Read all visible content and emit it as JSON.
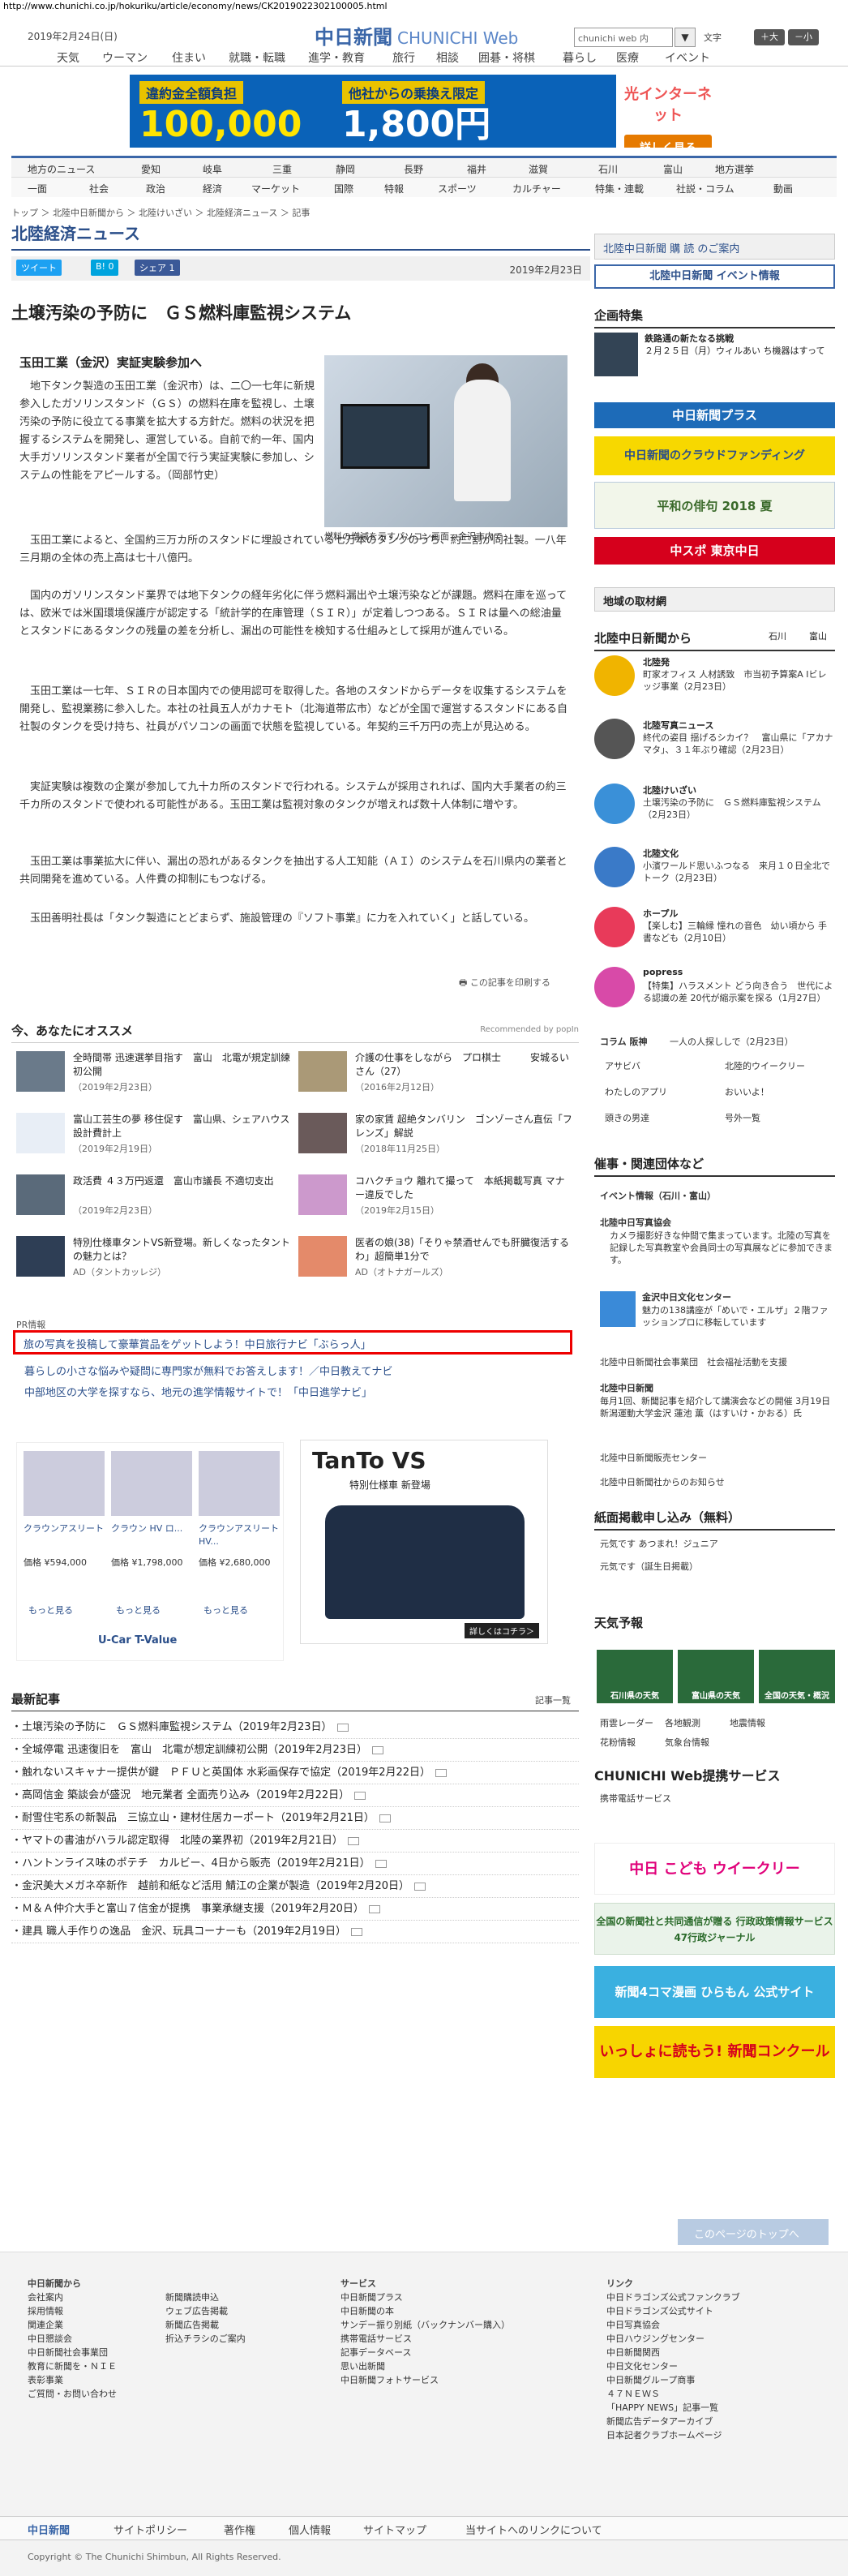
{
  "url": "http://www.chunichi.co.jp/hokuriku/article/economy/news/CK2019022302100005.html",
  "header": {
    "date": "2019年2月24日(日)",
    "logo": "中日新聞",
    "logo_sub": "CHUNICHI Web",
    "search_placeholder": "chunichi web 内",
    "search_btn": "▼",
    "font_label": "文字",
    "font_large": "＋大",
    "font_small": "－小"
  },
  "nav1": [
    "天気",
    "ウーマン",
    "住まい",
    "就職・転職",
    "進学・教育",
    "旅行",
    "相談",
    "囲碁・将棋",
    "暮らし",
    "医療",
    "イベント"
  ],
  "banner": {
    "tag1": "違約金全額負担",
    "amount1": "100,000円",
    "tag2": "他社からの乗換え限定",
    "amount2": "1,800円",
    "brand": "光インターネット",
    "cta": "詳しく見る"
  },
  "nav2": {
    "row1": [
      "地方のニュース",
      "愛知",
      "岐阜",
      "三重",
      "静岡",
      "長野",
      "福井",
      "滋賀",
      "石川",
      "富山",
      "地方選挙"
    ],
    "row2": [
      "一面",
      "社会",
      "政治",
      "経済",
      "マーケット",
      "国際",
      "特報",
      "スポーツ",
      "カルチャー",
      "特集・連載",
      "社説・コラム",
      "動画"
    ]
  },
  "breadcrumb": "トップ ＞ 北陸中日新聞から ＞ 北陸けいざい ＞ 北陸経済ニュース ＞ 記事",
  "section_title": "北陸経済ニュース",
  "share": {
    "tweet": "ツイート",
    "hatena": "B! 0",
    "fb": "シェア 1",
    "pub_date": "2019年2月23日"
  },
  "article": {
    "title": "土壌汚染の予防に　ＧＳ燃料庫監視システム",
    "subhead": "玉田工業（金沢）実証実験参加へ",
    "caption": "燃料の増減を示すパソコン画面＝金沢市内で",
    "p1": "　地下タンク製造の玉田工業（金沢市）は、二〇一七年に新規参入したガソリンスタンド（ＧＳ）の燃料在庫を監視し、土壌汚染の予防に役立てる事業を拡大する方針だ。燃料の状況を把握するシステムを開発し、運営している。自前で約一年、国内大手ガソリンスタンド業者が全国で行う実証実験に参加し、システムの性能をアピールする。（岡部竹史）",
    "p2": "　玉田工業によると、全国約三万カ所のスタンドに埋設されている七万本のタンクのうち、約二割が同社製。一八年三月期の全体の売上高は七十八億円。",
    "p3": "　国内のガソリンスタンド業界では地下タンクの経年劣化に伴う燃料漏出や土壌汚染などが課題。燃料在庫を巡っては、欧米では米国環境保護庁が認定する「統計学的在庫管理（ＳＩＲ）」が定着しつつある。ＳＩＲは量への総油量とスタンドにあるタンクの残量の差を分析し、漏出の可能性を検知する仕組みとして採用が進んでいる。",
    "p4": "　玉田工業は一七年、ＳＩＲの日本国内での使用認可を取得した。各地のスタンドからデータを収集するシステムを開発し、監視業務に参入した。本社の社員五人がカナモト（北海道帯広市）などが全国で運営するスタンドにある自社製のタンクを受け持ち、社員がパソコンの画面で状態を監視している。年契約三千万円の売上が見込める。",
    "p5": "　実証実験は複数の企業が参加して九十カ所のスタンドで行われる。システムが採用されれば、国内大手業者の約三千カ所のスタンドで使われる可能性がある。玉田工業は監視対象のタンクが増えれば数十人体制に増やす。",
    "p6": "　玉田工業は事業拡大に伴い、漏出の恐れがあるタンクを抽出する人工知能（ＡＩ）のシステムを石川県内の業者と共同開発を進めている。人件費の抑制にもつなげる。",
    "p7": "　玉田善明社長は「タンク製造にとどまらず、施設管理の『ソフト事業』に力を入れていく」と話している。",
    "print": "この記事を印刷する"
  },
  "recommend": {
    "title": "今、あなたにオススメ",
    "by": "Recommended by popIn",
    "items": [
      {
        "t": "全時間帯 迅速選挙目指す　富山　北電が規定訓練初公開",
        "d": "（2019年2月23日）"
      },
      {
        "t": "介護の仕事をしながら　プロ棋士　　　安城るいさん（27）",
        "d": "（2016年2月12日）"
      },
      {
        "t": "富山工芸生の夢 移住促す　富山県、シェアハウス設計費計上",
        "d": "（2019年2月19日）"
      },
      {
        "t": "家の家賃 超絶タンバリン　ゴンゾーさん直伝「フレンズ」解説",
        "d": "（2018年11月25日）"
      },
      {
        "t": "政活費 ４３万円返還　富山市議長 不適切支出",
        "d": "（2019年2月23日）"
      },
      {
        "t": "コハクチョウ 離れて撮って　本紙掲載写真 マナー違反でした",
        "d": "（2019年2月15日）"
      },
      {
        "t": "特別仕様車タントVS新登場。新しくなったタントの魅力とは？",
        "d": "AD（タントカッレジ）"
      },
      {
        "t": "医者の娘(38)「そりゃ禁酒せんでも肝臓復活するわ」超簡単1分で",
        "d": "AD（オトナガールズ）"
      }
    ]
  },
  "pr": {
    "label": "PR情報",
    "highlight": "旅の写真を投稿して豪華賞品をゲットしよう！中日旅行ナビ「ぶらっ人」",
    "l2": "暮らしの小さな悩みや疑問に専門家が無料でお答えします！／中日教えてナビ",
    "l3": "中部地区の大学を探すなら、地元の進学情報サイトで！「中日進学ナビ」"
  },
  "ad_car": {
    "cars": [
      {
        "n": "クラウンアスリート",
        "p": "価格 ¥594,000"
      },
      {
        "n": "クラウン HV ロ...",
        "p": "価格 ¥1,798,000"
      },
      {
        "n": "クラウンアスリート HV...",
        "p": "価格 ¥2,680,000"
      }
    ],
    "more": "もっと見る",
    "brand": "U-Car T-Value"
  },
  "ad_tanto": {
    "title": "TanTo VS",
    "sub": "特別仕様車 新登場",
    "cta": "詳しくはコチラ＞"
  },
  "latest": {
    "title": "最新記事",
    "more": "記事一覧",
    "items": [
      "土壌汚染の予防に　ＧＳ燃料庫監視システム（2019年2月23日）",
      "全城停電 迅速復旧を　富山　北電が想定訓練初公開（2019年2月23日）",
      "触れないスキャナー提供が鍵　ＰＦＵと英国体 水彩画保存で協定（2019年2月22日）",
      "高岡信金 築談会が盛況　地元業者 全面売り込み（2019年2月22日）",
      "耐雪住宅系の新製品　三協立山・建材住居カーポート（2019年2月21日）",
      "ヤマトの書油がハラル認定取得　北陸の業界初（2019年2月21日）",
      "ハントンライス味のポテチ　カルビー、4日から販売（2019年2月21日）",
      "金沢美大メガネ卒新作　越前和紙など活用 鯖江の企業が製造（2019年2月20日）",
      "Ｍ＆Ａ仲介大手と富山７信金が提携　事業承継支援（2019年2月20日）",
      "建具 職人手作りの逸品　金沢、玩具コーナーも（2019年2月19日）"
    ]
  },
  "sidebar": {
    "subscribe": "北陸中日新聞 購 読 のご案内",
    "event": "北陸中日新聞 イベント情報",
    "feature_h": "企画特集",
    "feature_title": "鉄路通の新たなる挑戦",
    "feature_text": "２月２５日（月）ウィルあい ち機器はすって",
    "bn1": "中日新聞プラス",
    "bn2": "中日新聞のクラウドファンディング",
    "bn3": "平和の俳句 2018 夏",
    "bn4": "中スポ 東京中日",
    "local": "地域の取材網",
    "hokuriku_h": "北陸中日新聞から",
    "tab_ishikawa": "石川",
    "tab_toyama": "富山",
    "items": [
      {
        "c": "北陸発",
        "t": "町家オフィス 人材誘致　市当初予算案A Iビレッジ事業（2月23日）"
      },
      {
        "c": "北陸写真ニュース",
        "t": "終代の姿目 揺げるシカイ？　富山県に「アカナマタ」、３１年ぶり確認（2月23日）"
      },
      {
        "c": "北陸けいざい",
        "t": "土壌汚染の予防に　ＧＳ燃料庫監視システム（2月23日）"
      },
      {
        "c": "北陸文化",
        "t": "小濱ワールド思いふつなる　来月１０日全北でトーク（2月23日）"
      },
      {
        "c": "ホープル",
        "t": "【楽しむ】三輪縁 憧れの音色　幼い頃から 手書なども（2月10日）"
      },
      {
        "c": "popress",
        "t": "【特集】ハラスメント どう向き合う　世代による認識の差 20代が縮示案を探る（1月27日）"
      }
    ],
    "cols": [
      "コラム 阪神",
      "一人の人探ししで（2月23日）",
      "アサビバ",
      "北陸的ウイークリー",
      "わたしのアプリ",
      "おいいよ！",
      "頭きの男達",
      "号外一覧"
    ],
    "sponsor_h": "催事・関連団体など",
    "event_info": "イベント情報（石川・富山）",
    "photo_h": "北陸中日写真協会",
    "photo_t": "カメラ撮影好きな仲間で集まっています。北陸の写真を記録した写真教室や会員同士の写真展などに参加できます。",
    "ktc_h": "金沢中日文化センター",
    "ktc_t": "魅力の138講座が「めいで・エルザ」２階ファッションプロに移転しています",
    "hs_t": "北陸中日新聞社会事業団　社会福祉活動を支援",
    "ed_h": "北陸中日新聞",
    "ed_t": "毎月1回、新聞記事を紹介して講演会などの開催 3月19日 新潟運動大学金沢 蓮池 薫（はすいけ・かおる）氏",
    "pt": "北陸中日新聞販売センター",
    "contact": "北陸中日新聞社からのお知らせ",
    "kamen_h": "紙面掲載申し込み（無料）",
    "kamen1": "元気です あつまれ！ジュニア",
    "kamen2": "元気です（誕生日掲載）",
    "wx_h": "天気予報",
    "wx": [
      "石川県の天気",
      "富山県の天気",
      "全国の天気・概況"
    ],
    "wxl": [
      "雨雲レーダー",
      "各地観測",
      "地震情報",
      "花粉情報",
      "気象台情報"
    ],
    "svc_h": "CHUNICHI Web提携サービス",
    "svc1": "携帯電話サービス",
    "ad1": "中日 こども ウイークリー",
    "ad2": "全国の新聞社と共同通信が贈る 行政政策情報サービス 47行政ジャーナル",
    "ad3": "新聞4コマ漫画 ひらもん 公式サイト",
    "ad4": "いっしょに読もう! 新聞コンクール"
  },
  "gotop": "このページのトップへ",
  "footer": {
    "c1h": "中日新聞から",
    "c1": [
      "会社案内",
      "採用情報",
      "関連企業",
      "中日懇談会",
      "中日新聞社会事業団",
      "教育に新聞を・ＮＩＥ",
      "表彰事業",
      "ご質問・お問い合わせ"
    ],
    "c2": [
      "新聞購読申込",
      "ウェブ広告掲載",
      "新聞広告掲載",
      "折込チラシのご案内"
    ],
    "c3h": "サービス",
    "c3": [
      "中日新聞プラス",
      "中日新聞の本",
      "サンデー振り別紙（バックナンバー購入）",
      "携帯電話サービス",
      "記事データベース",
      "思い出新聞",
      "中日新聞フォトサービス"
    ],
    "c4h": "リンク",
    "c4": [
      "中日ドラゴンズ公式ファンクラブ",
      "中日ドラゴンズ公式サイト",
      "中日写真協会",
      "中日ハウジングセンター",
      "中日新聞関西",
      "中日文化センター",
      "中日新聞グループ商事",
      "４７ＮＥＷＳ",
      "「HAPPY NEWS」記事一覧",
      "新聞広告データアーカイブ",
      "日本記者クラブホームページ"
    ],
    "bar": [
      "中日新聞",
      "サイトポリシー",
      "著作権",
      "個人情報",
      "サイトマップ",
      "当サイトへのリンクについて"
    ],
    "copy": "Copyright © The Chunichi Shimbun, All Rights Reserved."
  }
}
